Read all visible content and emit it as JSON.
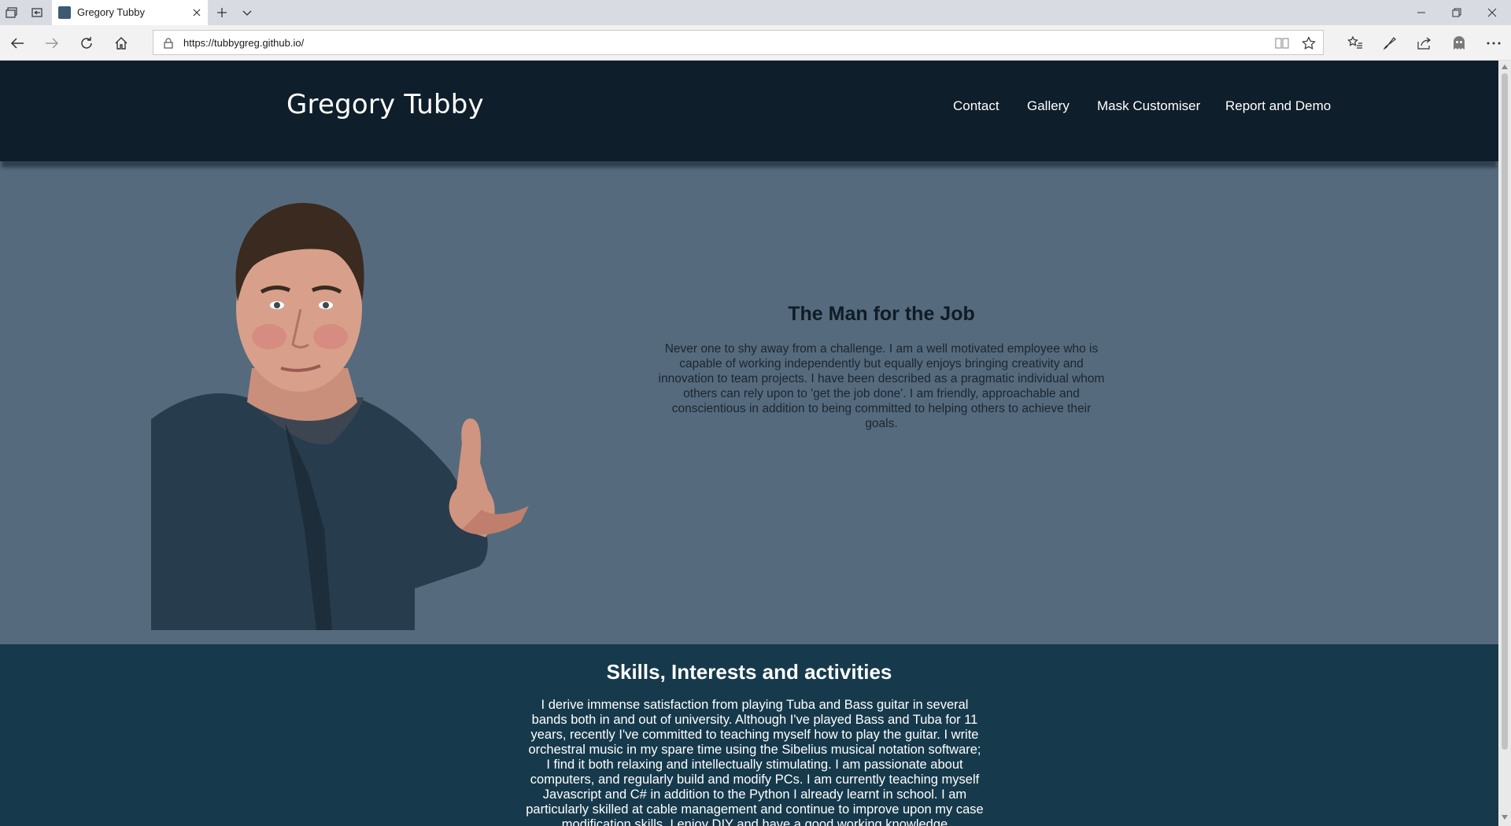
{
  "browser": {
    "tab_title": "Gregory Tubby",
    "url": "https://tubbygreg.github.io/"
  },
  "site": {
    "brand": "Gregory Tubby",
    "nav": [
      "Contact",
      "Gallery",
      "Mask Customiser",
      "Report and Demo"
    ]
  },
  "hero": {
    "title": "The Man for the Job",
    "body": "Never one to shy away from a challenge. I am a well motivated employee who is capable of working independently but equally enjoys bringing creativity and innovation to team projects. I have been described as a pragmatic individual whom others can rely upon to 'get the job done'. I am friendly, approachable and conscientious in addition to being committed to helping others to achieve their goals."
  },
  "skills": {
    "title": "Skills, Interests and activities",
    "body": "I derive immense satisfaction from playing Tuba and Bass guitar in several bands both in and out of university. Although I've played Bass and Tuba for 11 years, recently I've committed to teaching myself how to play the guitar. I write orchestral music in my spare time using the Sibelius musical notation software; I find it both relaxing and intellectually stimulating. I am passionate about computers, and regularly build and modify PCs. I am currently teaching myself Javascript and C# in addition to the Python I already learnt in school. I am particularly skilled at cable management and continue to improve upon my case modification skills. I enjoy DIY and have a good working knowledge"
  },
  "colors": {
    "header_bg": "#0e1e2b",
    "hero_bg": "#566a7d",
    "skills_bg": "#163a4b"
  }
}
